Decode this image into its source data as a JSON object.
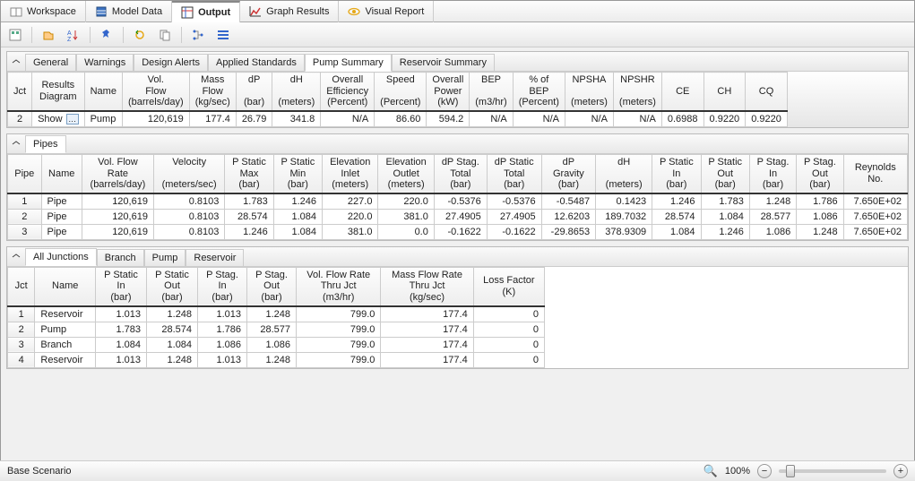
{
  "mainTabs": {
    "workspace": "Workspace",
    "modelData": "Model Data",
    "output": "Output",
    "graphResults": "Graph Results",
    "visualReport": "Visual Report"
  },
  "panels": {
    "summary": {
      "tabs": {
        "general": "General",
        "warnings": "Warnings",
        "designAlerts": "Design Alerts",
        "appliedStd": "Applied Standards",
        "pumpSummary": "Pump Summary",
        "reservoirSummary": "Reservoir Summary"
      },
      "headers": {
        "jct": "Jct",
        "results": "Results\nDiagram",
        "name": "Name",
        "volFlow": "Vol.\nFlow\n(barrels/day)",
        "massFlow": "Mass\nFlow\n(kg/sec)",
        "dP": "dP\n\n(bar)",
        "dH": "dH\n\n(meters)",
        "overallEff": "Overall\nEfficiency\n(Percent)",
        "speed": "Speed\n\n(Percent)",
        "overallPower": "Overall\nPower\n(kW)",
        "bep": "BEP\n\n(m3/hr)",
        "pctBep": "% of\nBEP\n(Percent)",
        "npsha": "NPSHA\n\n(meters)",
        "npshr": "NPSHR\n\n(meters)",
        "ce": "CE",
        "ch": "CH",
        "cq": "CQ"
      },
      "row": {
        "jct": "2",
        "show": "Show",
        "name": "Pump",
        "volFlow": "120,619",
        "massFlow": "177.4",
        "dP": "26.79",
        "dH": "341.8",
        "overallEff": "N/A",
        "speed": "86.60",
        "overallPower": "594.2",
        "bep": "N/A",
        "pctBep": "N/A",
        "npsha": "N/A",
        "npshr": "N/A",
        "ce": "0.6988",
        "ch": "0.9220",
        "cq": "0.9220"
      }
    },
    "pipes": {
      "tab": "Pipes",
      "headers": {
        "pipe": "Pipe",
        "name": "Name",
        "volFlow": "Vol. Flow\nRate\n(barrels/day)",
        "velocity": "Velocity\n\n(meters/sec)",
        "psMax": "P Static\nMax\n(bar)",
        "psMin": "P Static\nMin\n(bar)",
        "elevIn": "Elevation\nInlet\n(meters)",
        "elevOut": "Elevation\nOutlet\n(meters)",
        "dpStag": "dP Stag.\nTotal\n(bar)",
        "dpStatic": "dP Static\nTotal\n(bar)",
        "dpGrav": "dP\nGravity\n(bar)",
        "dH": "dH\n\n(meters)",
        "psIn": "P Static\nIn\n(bar)",
        "psOut": "P Static\nOut\n(bar)",
        "pstagIn": "P Stag.\nIn\n(bar)",
        "pstagOut": "P Stag.\nOut\n(bar)",
        "reynolds": "Reynolds\nNo."
      },
      "rows": [
        {
          "pipe": "1",
          "name": "Pipe",
          "volFlow": "120,619",
          "velocity": "0.8103",
          "psMax": "1.783",
          "psMin": "1.246",
          "elevIn": "227.0",
          "elevOut": "220.0",
          "dpStag": "-0.5376",
          "dpStatic": "-0.5376",
          "dpGrav": "-0.5487",
          "dH": "0.1423",
          "psIn": "1.246",
          "psOut": "1.783",
          "pstagIn": "1.248",
          "pstagOut": "1.786",
          "reynolds": "7.650E+02"
        },
        {
          "pipe": "2",
          "name": "Pipe",
          "volFlow": "120,619",
          "velocity": "0.8103",
          "psMax": "28.574",
          "psMin": "1.084",
          "elevIn": "220.0",
          "elevOut": "381.0",
          "dpStag": "27.4905",
          "dpStatic": "27.4905",
          "dpGrav": "12.6203",
          "dH": "189.7032",
          "psIn": "28.574",
          "psOut": "1.084",
          "pstagIn": "28.577",
          "pstagOut": "1.086",
          "reynolds": "7.650E+02"
        },
        {
          "pipe": "3",
          "name": "Pipe",
          "volFlow": "120,619",
          "velocity": "0.8103",
          "psMax": "1.246",
          "psMin": "1.084",
          "elevIn": "381.0",
          "elevOut": "0.0",
          "dpStag": "-0.1622",
          "dpStatic": "-0.1622",
          "dpGrav": "-29.8653",
          "dH": "378.9309",
          "psIn": "1.084",
          "psOut": "1.246",
          "pstagIn": "1.086",
          "pstagOut": "1.248",
          "reynolds": "7.650E+02"
        }
      ]
    },
    "junctions": {
      "tabs": {
        "all": "All Junctions",
        "branch": "Branch",
        "pump": "Pump",
        "reservoir": "Reservoir"
      },
      "headers": {
        "jct": "Jct",
        "name": "Name",
        "psIn": "P Static\nIn\n(bar)",
        "psOut": "P Static\nOut\n(bar)",
        "pstagIn": "P Stag.\nIn\n(bar)",
        "pstagOut": "P Stag.\nOut\n(bar)",
        "volFlow": "Vol. Flow Rate\nThru Jct\n(m3/hr)",
        "massFlow": "Mass Flow Rate\nThru Jct\n(kg/sec)",
        "loss": "Loss Factor\n(K)"
      },
      "rows": [
        {
          "jct": "1",
          "name": "Reservoir",
          "psIn": "1.013",
          "psOut": "1.248",
          "pstagIn": "1.013",
          "pstagOut": "1.248",
          "volFlow": "799.0",
          "massFlow": "177.4",
          "loss": "0"
        },
        {
          "jct": "2",
          "name": "Pump",
          "psIn": "1.783",
          "psOut": "28.574",
          "pstagIn": "1.786",
          "pstagOut": "28.577",
          "volFlow": "799.0",
          "massFlow": "177.4",
          "loss": "0"
        },
        {
          "jct": "3",
          "name": "Branch",
          "psIn": "1.084",
          "psOut": "1.084",
          "pstagIn": "1.086",
          "pstagOut": "1.086",
          "volFlow": "799.0",
          "massFlow": "177.4",
          "loss": "0"
        },
        {
          "jct": "4",
          "name": "Reservoir",
          "psIn": "1.013",
          "psOut": "1.248",
          "pstagIn": "1.013",
          "pstagOut": "1.248",
          "volFlow": "799.0",
          "massFlow": "177.4",
          "loss": "0"
        }
      ]
    }
  },
  "status": {
    "scenario": "Base Scenario",
    "zoom": "100%"
  }
}
